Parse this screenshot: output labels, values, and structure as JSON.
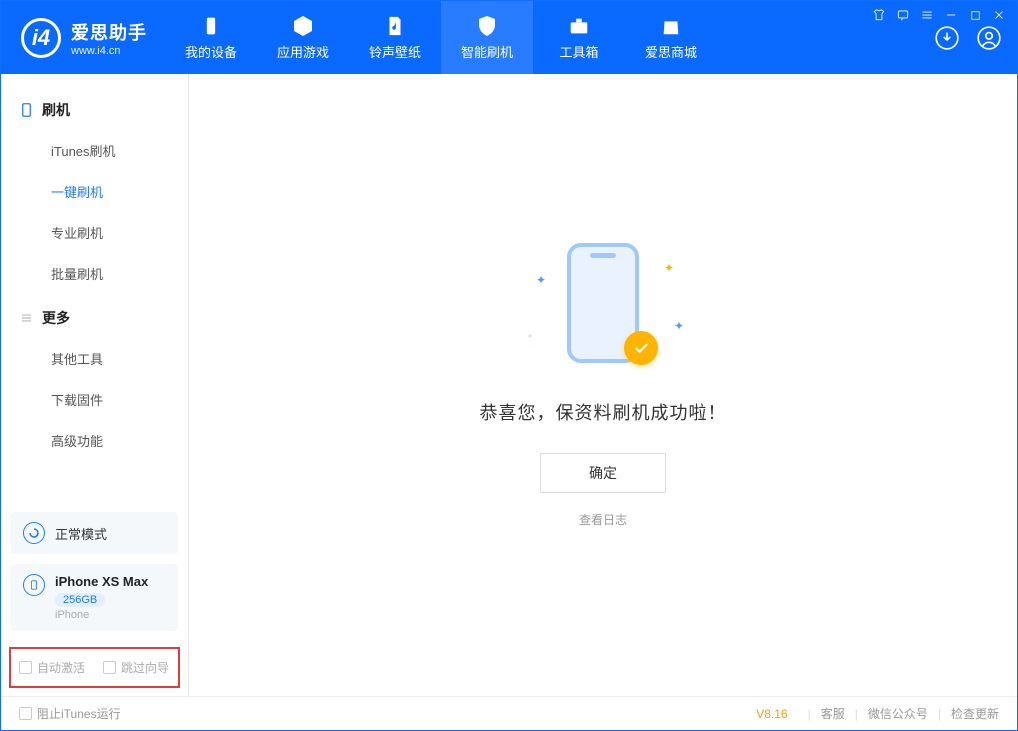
{
  "app": {
    "name": "爱思助手",
    "url": "www.i4.cn"
  },
  "nav": [
    {
      "label": "我的设备"
    },
    {
      "label": "应用游戏"
    },
    {
      "label": "铃声壁纸"
    },
    {
      "label": "智能刷机"
    },
    {
      "label": "工具箱"
    },
    {
      "label": "爱思商城"
    }
  ],
  "sidebar": {
    "group1": {
      "title": "刷机",
      "items": [
        "iTunes刷机",
        "一键刷机",
        "专业刷机",
        "批量刷机"
      ]
    },
    "group2": {
      "title": "更多",
      "items": [
        "其他工具",
        "下载固件",
        "高级功能"
      ]
    }
  },
  "device": {
    "mode": "正常模式",
    "name": "iPhone XS Max",
    "storage": "256GB",
    "type": "iPhone"
  },
  "options": {
    "auto_activate": "自动激活",
    "skip_guide": "跳过向导"
  },
  "main": {
    "success_msg": "恭喜您，保资料刷机成功啦！",
    "ok_btn": "确定",
    "view_log": "查看日志"
  },
  "footer": {
    "block_itunes": "阻止iTunes运行",
    "version": "V8.16",
    "links": [
      "客服",
      "微信公众号",
      "检查更新"
    ]
  }
}
